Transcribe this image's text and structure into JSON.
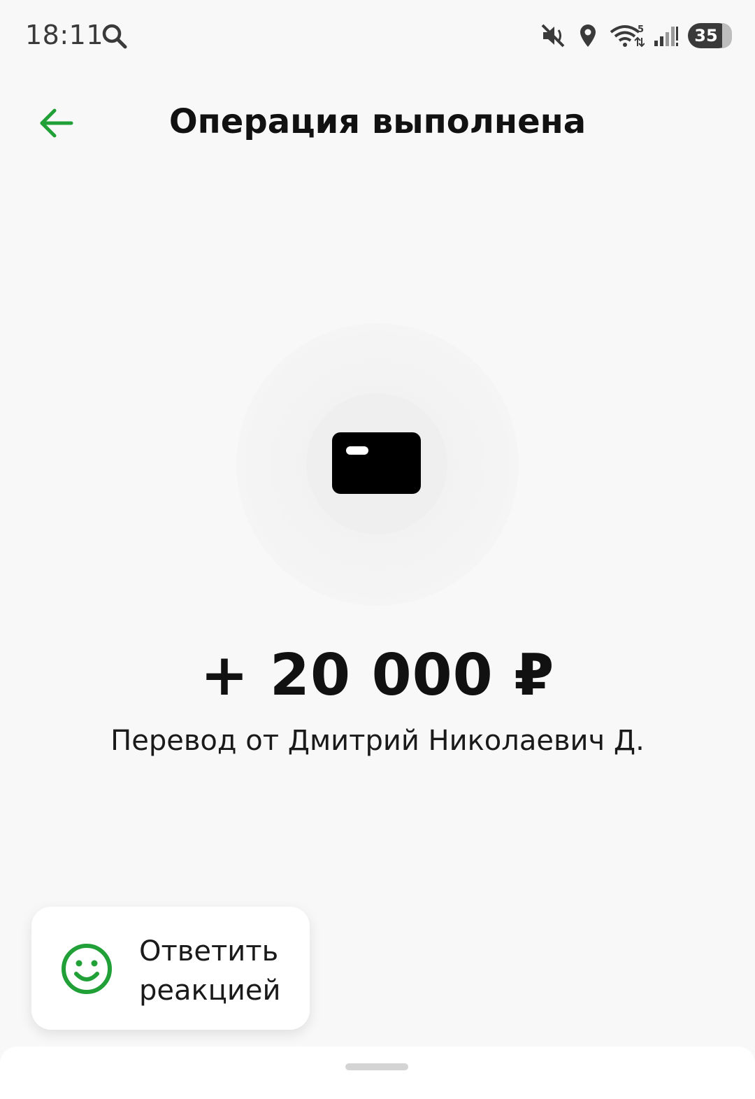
{
  "status_bar": {
    "time": "18:11",
    "battery_level": "35",
    "icons": [
      "search-icon",
      "mute-icon",
      "location-icon",
      "wifi-icon",
      "signal-icon",
      "battery-icon"
    ]
  },
  "header": {
    "title": "Операция выполнена",
    "back_icon": "arrow-left-icon"
  },
  "operation": {
    "icon": "card-icon",
    "amount": "+ 20 000 ₽",
    "description": "Перевод от Дмитрий Николаевич Д."
  },
  "reaction_button": {
    "label": "Ответить реакцией",
    "icon": "smile-icon"
  },
  "colors": {
    "accent": "#21a038",
    "background": "#f8f8f8",
    "text": "#111111"
  }
}
